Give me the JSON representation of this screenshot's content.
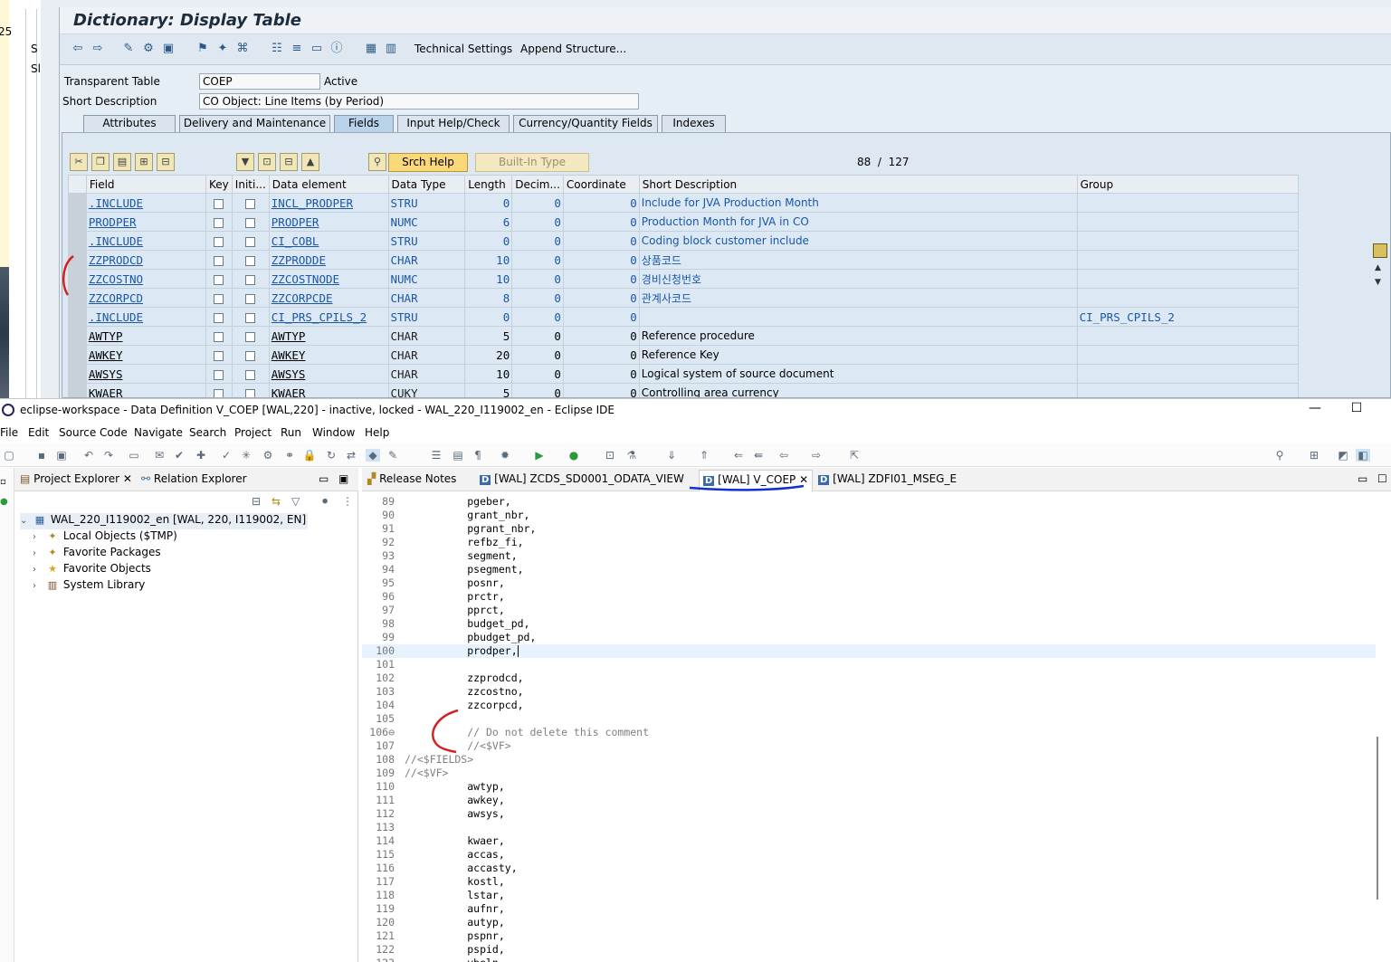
{
  "bg_window": {
    "fragments": [
      "25",
      "S",
      "Sl"
    ]
  },
  "sap": {
    "title": "Dictionary: Display Table",
    "toolbar": {
      "technical_settings": "Technical Settings",
      "append_structure": "Append Structure..."
    },
    "header": {
      "transparent_table_label": "Transparent Table",
      "table_name": "COEP",
      "status": "Active",
      "short_desc_label": "Short Description",
      "short_desc": "CO Object: Line Items (by Period)"
    },
    "tabs": [
      "Attributes",
      "Delivery and Maintenance",
      "Fields",
      "Input Help/Check",
      "Currency/Quantity Fields",
      "Indexes"
    ],
    "active_tab": "Fields",
    "buttons": {
      "srch_help": "Srch Help",
      "built_in_type": "Built-In Type"
    },
    "counter": {
      "current": "88",
      "sep": "/",
      "total": "127"
    },
    "columns": [
      "Field",
      "Key",
      "Initi...",
      "Data element",
      "Data Type",
      "Length",
      "Decim...",
      "Coordinate",
      "Short Description",
      "Group"
    ],
    "rows": [
      {
        "field": ".INCLUDE",
        "data_element": "INCL_PRODPER",
        "data_type": "STRU",
        "length": "0",
        "decimals": "0",
        "coordinate": "0",
        "desc": "Include for JVA Production Month",
        "group": "",
        "style": "link"
      },
      {
        "field": "PRODPER",
        "data_element": "PRODPER",
        "data_type": "NUMC",
        "length": "6",
        "decimals": "0",
        "coordinate": "0",
        "desc": "Production Month for JVA in CO",
        "group": "",
        "style": "link"
      },
      {
        "field": ".INCLUDE",
        "data_element": "CI_COBL",
        "data_type": "STRU",
        "length": "0",
        "decimals": "0",
        "coordinate": "0",
        "desc": "Coding block customer include",
        "group": "",
        "style": "link"
      },
      {
        "field": "ZZPRODCD",
        "data_element": "ZZPRODDE",
        "data_type": "CHAR",
        "length": "10",
        "decimals": "0",
        "coordinate": "0",
        "desc": "상품코드",
        "group": "",
        "style": "link"
      },
      {
        "field": "ZZCOSTNO",
        "data_element": "ZZCOSTNODE",
        "data_type": "NUMC",
        "length": "10",
        "decimals": "0",
        "coordinate": "0",
        "desc": "경비신청번호",
        "group": "",
        "style": "link"
      },
      {
        "field": "ZZCORPCD",
        "data_element": "ZZCORPCDE",
        "data_type": "CHAR",
        "length": "8",
        "decimals": "0",
        "coordinate": "0",
        "desc": "관계사코드",
        "group": "",
        "style": "link"
      },
      {
        "field": ".INCLUDE",
        "data_element": "CI_PRS_CPILS_2",
        "data_type": "STRU",
        "length": "0",
        "decimals": "0",
        "coordinate": "0",
        "desc": "",
        "group": "CI_PRS_CPILS_2",
        "style": "link"
      },
      {
        "field": "AWTYP",
        "data_element": "AWTYP",
        "data_type": "CHAR",
        "length": "5",
        "decimals": "0",
        "coordinate": "0",
        "desc": "Reference procedure",
        "group": "",
        "style": "plain"
      },
      {
        "field": "AWKEY",
        "data_element": "AWKEY",
        "data_type": "CHAR",
        "length": "20",
        "decimals": "0",
        "coordinate": "0",
        "desc": "Reference Key",
        "group": "",
        "style": "plain"
      },
      {
        "field": "AWSYS",
        "data_element": "AWSYS",
        "data_type": "CHAR",
        "length": "10",
        "decimals": "0",
        "coordinate": "0",
        "desc": "Logical system of source document",
        "group": "",
        "style": "plain"
      },
      {
        "field": "KWAER",
        "data_element": "KWAER",
        "data_type": "CUKY",
        "length": "5",
        "decimals": "0",
        "coordinate": "0",
        "desc": "Controlling area currency",
        "group": "",
        "style": "plain"
      }
    ]
  },
  "eclipse": {
    "title": "eclipse-workspace - Data Definition V_COEP [WAL,220] - inactive, locked - WAL_220_I119002_en - Eclipse IDE",
    "menu": [
      "File",
      "Edit",
      "Source Code",
      "Navigate",
      "Search",
      "Project",
      "Run",
      "Window",
      "Help"
    ],
    "left_tabs": [
      "Project Explorer",
      "Relation Explorer"
    ],
    "tree": {
      "root": "WAL_220_I119002_en [WAL, 220, I119002, EN]",
      "children": [
        "Local Objects ($TMP)",
        "Favorite Packages",
        "Favorite Objects",
        "System Library"
      ]
    },
    "editor_tabs": [
      "Release Notes",
      "[WAL] ZCDS_SD0001_ODATA_VIEW",
      "[WAL] V_COEP",
      "[WAL] ZDFI01_MSEG_E"
    ],
    "active_editor_tab": "[WAL] V_COEP",
    "code": [
      {
        "n": "89",
        "t": "          pgeber,"
      },
      {
        "n": "90",
        "t": "          grant_nbr,"
      },
      {
        "n": "91",
        "t": "          pgrant_nbr,"
      },
      {
        "n": "92",
        "t": "          refbz_fi,"
      },
      {
        "n": "93",
        "t": "          segment,"
      },
      {
        "n": "94",
        "t": "          psegment,"
      },
      {
        "n": "95",
        "t": "          posnr,"
      },
      {
        "n": "96",
        "t": "          prctr,"
      },
      {
        "n": "97",
        "t": "          pprct,"
      },
      {
        "n": "98",
        "t": "          budget_pd,"
      },
      {
        "n": "99",
        "t": "          pbudget_pd,"
      },
      {
        "n": "100",
        "t": "          prodper,",
        "cur": true
      },
      {
        "n": "101",
        "t": ""
      },
      {
        "n": "102",
        "t": "          zzprodcd,"
      },
      {
        "n": "103",
        "t": "          zzcostno,"
      },
      {
        "n": "104",
        "t": "          zzcorpcd,"
      },
      {
        "n": "105",
        "t": ""
      },
      {
        "n": "106⊖",
        "t": "          // Do not delete this comment",
        "cmt": true
      },
      {
        "n": "107",
        "t": "          //<$VF>",
        "cmt": true
      },
      {
        "n": "108",
        "t": "//<$FIELDS>",
        "cmt": true
      },
      {
        "n": "109",
        "t": "//<$VF>",
        "cmt": true
      },
      {
        "n": "110",
        "t": "          awtyp,"
      },
      {
        "n": "111",
        "t": "          awkey,"
      },
      {
        "n": "112",
        "t": "          awsys,"
      },
      {
        "n": "113",
        "t": ""
      },
      {
        "n": "114",
        "t": "          kwaer,"
      },
      {
        "n": "115",
        "t": "          accas,"
      },
      {
        "n": "116",
        "t": "          accasty,"
      },
      {
        "n": "117",
        "t": "          kostl,"
      },
      {
        "n": "118",
        "t": "          lstar,"
      },
      {
        "n": "119",
        "t": "          aufnr,"
      },
      {
        "n": "120",
        "t": "          autyp,"
      },
      {
        "n": "121",
        "t": "          pspnr,"
      },
      {
        "n": "122",
        "t": "          pspid,"
      },
      {
        "n": "123",
        "t": "          vbeln,"
      }
    ]
  },
  "colors": {
    "link": "#1a56a8",
    "annotation_red": "#d42020",
    "annotation_blue": "#1030d0",
    "sap_bg": "#e6eef5"
  }
}
